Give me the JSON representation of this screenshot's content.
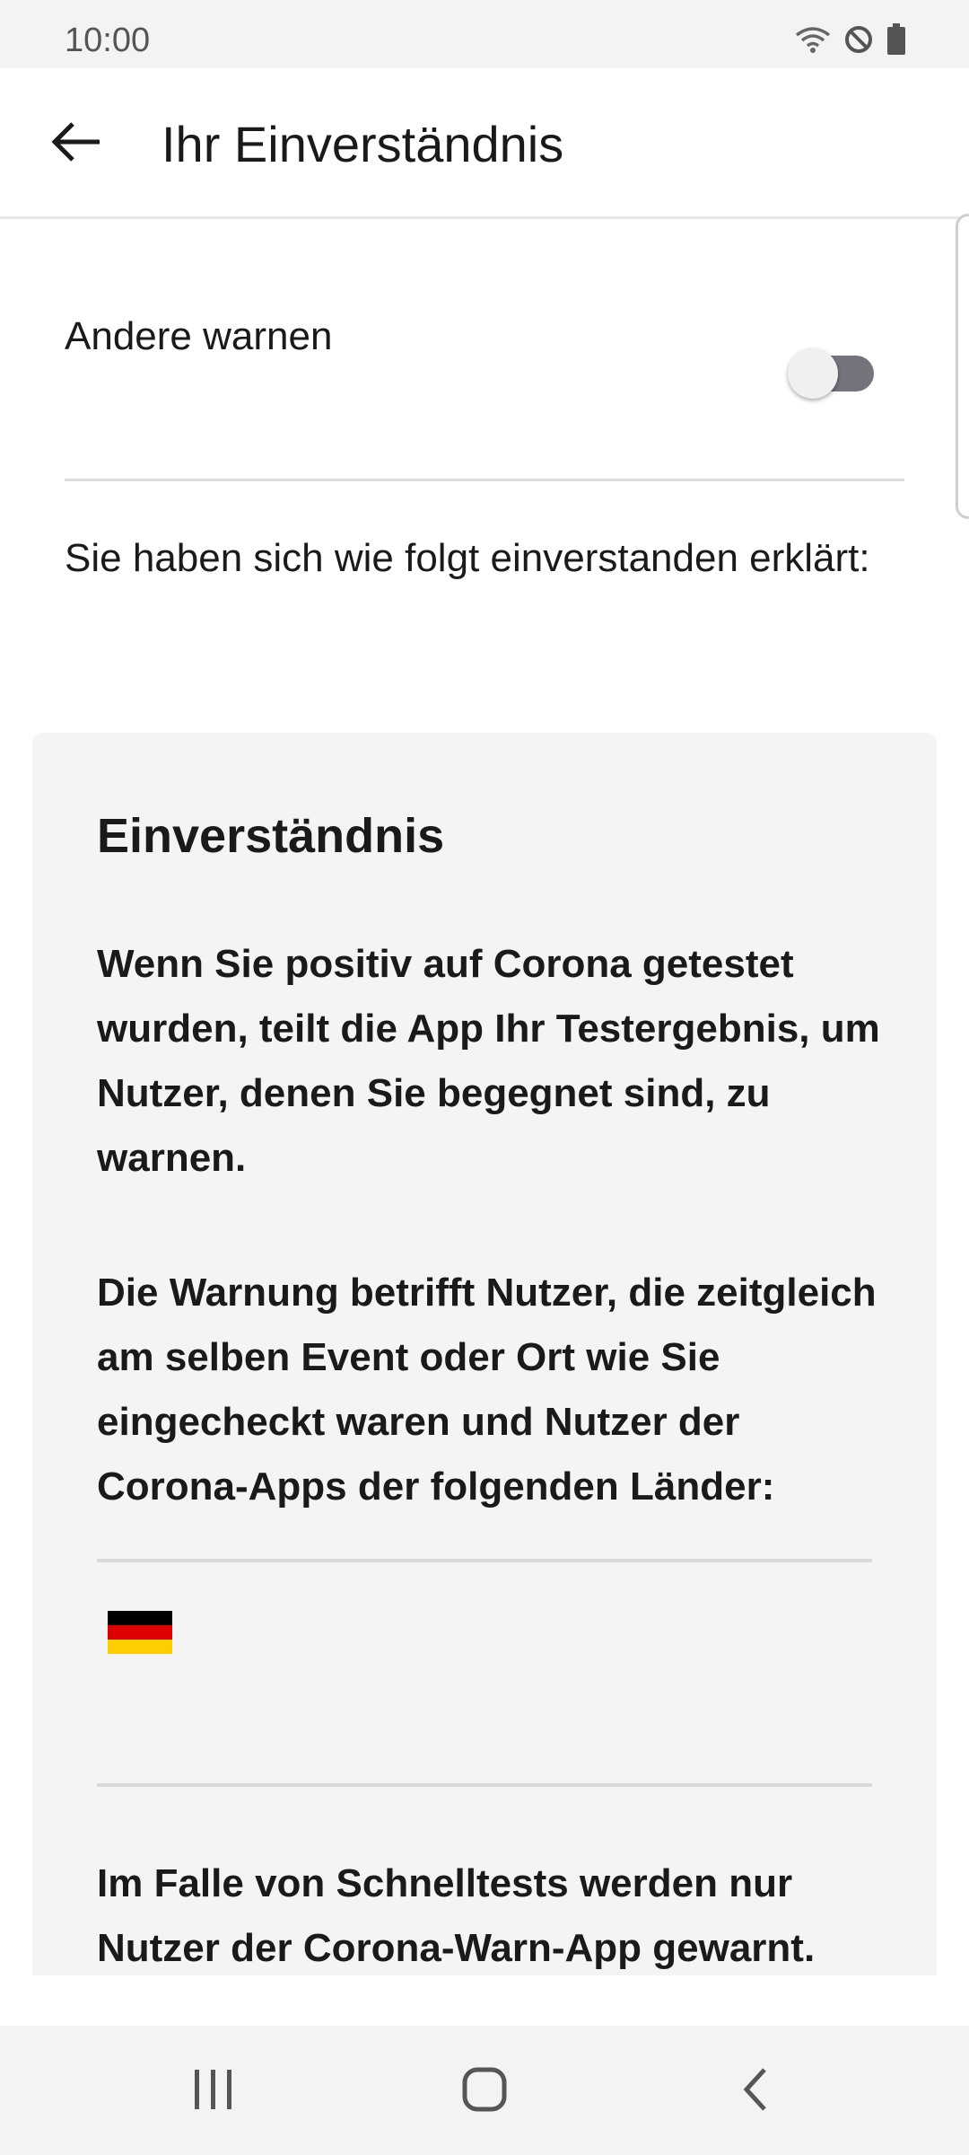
{
  "status_bar": {
    "time": "10:00",
    "icons": [
      "wifi-icon",
      "do-not-disturb-icon",
      "battery-icon"
    ]
  },
  "app_bar": {
    "back_icon": "arrow-left-icon",
    "title": "Ihr Einverständnis"
  },
  "toggle": {
    "label": "Andere warnen",
    "checked": false
  },
  "intro": "Sie haben sich wie folgt einverstanden erklärt:",
  "card": {
    "title": "Einverständnis",
    "paragraph_1": "Wenn Sie positiv auf Corona getestet wurden, teilt die App Ihr Testergebnis, um Nutzer, denen Sie begegnet sind, zu warnen.",
    "paragraph_2": "Die Warnung betrifft Nutzer, die zeitgleich am selben Event oder Ort wie Sie eingecheckt waren und Nutzer der Corona-Apps der folgenden Länder:",
    "countries": [
      "germany-flag-icon"
    ],
    "paragraph_3": "Im Falle von Schnelltests werden nur Nutzer der Corona-Warn-App gewarnt."
  },
  "nav_bar": {
    "items": [
      "recent-apps-icon",
      "home-icon",
      "back-icon"
    ]
  },
  "colors": {
    "switch_track": "#77737d",
    "card_background": "#f4f4f4",
    "flag_black": "#000000",
    "flag_red": "#dd0000",
    "flag_gold": "#ffce00"
  }
}
